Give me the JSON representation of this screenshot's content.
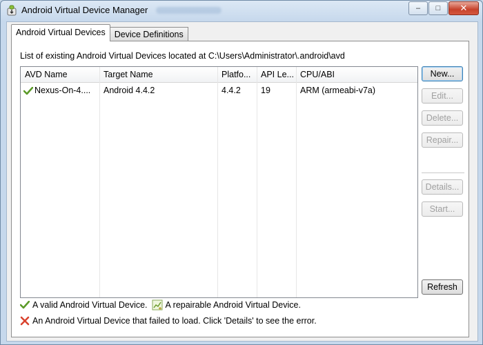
{
  "window": {
    "title": "Android Virtual Device Manager",
    "controls": {
      "minimize": "–",
      "maximize": "□",
      "close": "✕"
    }
  },
  "tabs": [
    {
      "label": "Android Virtual Devices",
      "active": true
    },
    {
      "label": "Device Definitions",
      "active": false
    }
  ],
  "location_label": "List of existing Android Virtual Devices located at C:\\Users\\Administrator\\.android\\avd",
  "table": {
    "columns": [
      "AVD Name",
      "Target Name",
      "Platfo...",
      "API Le...",
      "CPU/ABI"
    ],
    "rows": [
      {
        "status_icon": "valid-check-icon",
        "avd_name": "Nexus-On-4....",
        "target_name": "Android 4.4.2",
        "platform": "4.4.2",
        "api_level": "19",
        "cpu_abi": "ARM (armeabi-v7a)"
      }
    ]
  },
  "buttons": {
    "new": "New...",
    "edit": "Edit...",
    "delete": "Delete...",
    "repair": "Repair...",
    "details": "Details...",
    "start": "Start...",
    "refresh": "Refresh"
  },
  "legend": {
    "valid": "A valid Android Virtual Device.",
    "repairable": "A repairable Android Virtual Device.",
    "failed": "An Android Virtual Device that failed to load. Click 'Details' to see the error."
  },
  "colors": {
    "valid": "#5b9a28",
    "failed": "#d9432f",
    "accent": "#3c7fb1"
  }
}
